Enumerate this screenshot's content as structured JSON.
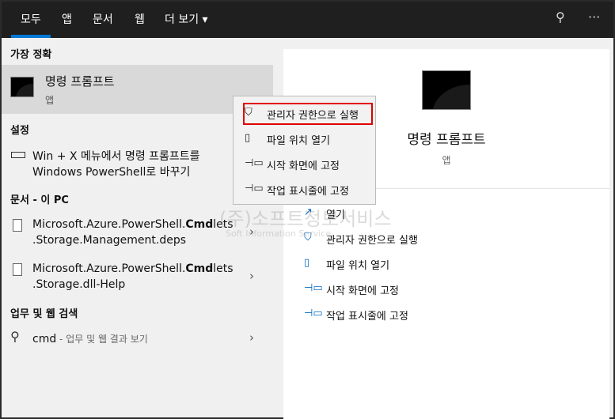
{
  "tabs": [
    {
      "label": "모두"
    },
    {
      "label": "앱"
    },
    {
      "label": "문서"
    },
    {
      "label": "웹"
    },
    {
      "label": "더 보기 ▾"
    }
  ],
  "toolbar": {
    "feedback_icon": "feedback-icon",
    "more": "···"
  },
  "sections": {
    "best": "가장 정확",
    "settings": "설정",
    "docs": "문서 - 이 PC",
    "web": "업무 및 웹 검색"
  },
  "best_match": {
    "title": "명령 프롬프트",
    "sub": "앱"
  },
  "setting_item": {
    "line1": "Win + X 메뉴에서 명령 프롬프트를",
    "line2": "Windows PowerShell로 바꾸기"
  },
  "documents": [
    {
      "pre": "Microsoft.Azure.PowerShell.",
      "bold": "Cmd",
      "post": "lets",
      "line2": ".Storage.Management.deps"
    },
    {
      "pre": "Microsoft.Azure.PowerShell.",
      "bold": "Cmd",
      "post": "lets",
      "line2": ".Storage.dll-Help"
    }
  ],
  "web_search": {
    "query": "cmd",
    "suffix": " - 업무 및 웹 결과 보기"
  },
  "context_menu": [
    {
      "label": "관리자 권한으로 실행"
    },
    {
      "label": "파일 위치 열기"
    },
    {
      "label": "시작 화면에 고정"
    },
    {
      "label": "작업 표시줄에 고정"
    }
  ],
  "detail": {
    "title": "명령 프롬프트",
    "sub": "앱",
    "actions": [
      {
        "label": "열기"
      },
      {
        "label": "관리자 권한으로 실행"
      },
      {
        "label": "파일 위치 열기"
      },
      {
        "label": "시작 화면에 고정"
      },
      {
        "label": "작업 표시줄에 고정"
      }
    ]
  },
  "watermark": {
    "line1": "(주)소프트정보서비스",
    "line2": "Soft Information Service"
  },
  "colors": {
    "accent": "#0078d7",
    "highlight": "#e00000"
  }
}
